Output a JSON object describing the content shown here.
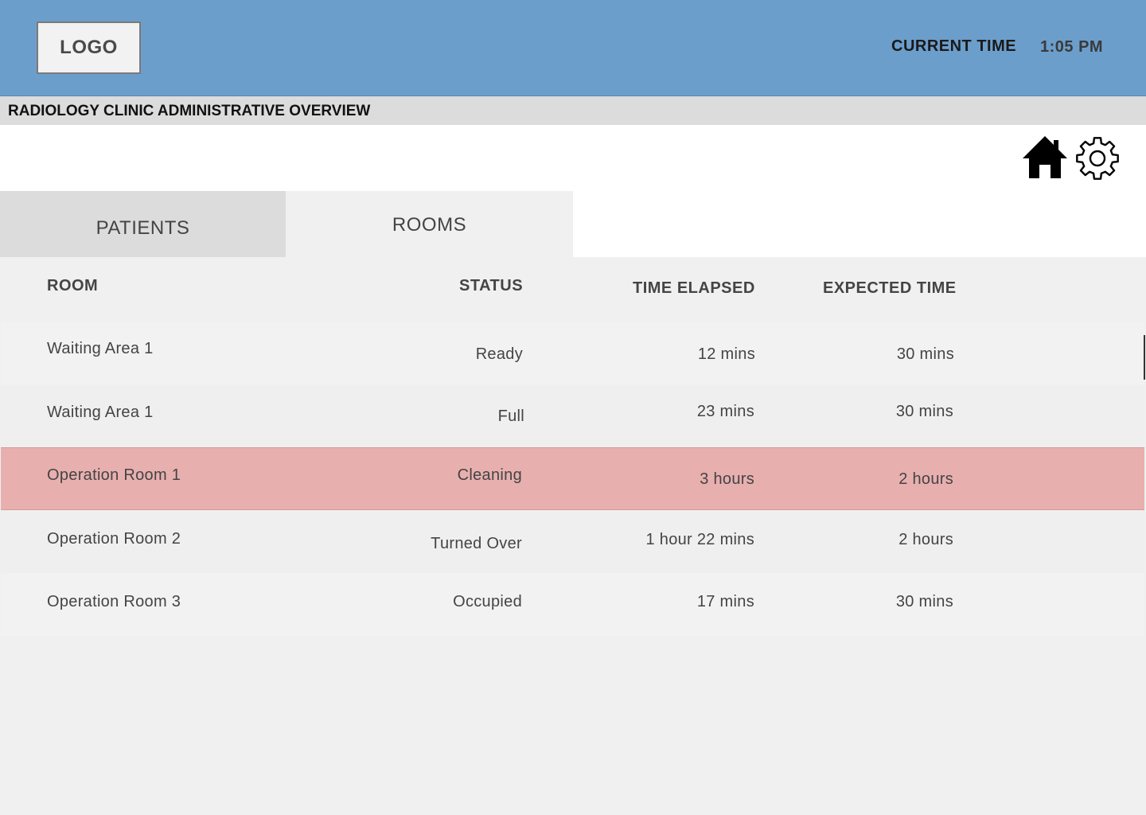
{
  "header": {
    "logo": "LOGO",
    "current_time_label": "CURRENT TIME",
    "current_time_value": "1:05 PM",
    "background_color": "#6c9ecb"
  },
  "subheader": {
    "title": "RADIOLOGY CLINIC ADMINISTRATIVE OVERVIEW"
  },
  "toolbar": {
    "icons": [
      "home-icon",
      "gear-icon"
    ]
  },
  "tabs": [
    {
      "label": "PATIENTS",
      "active": false
    },
    {
      "label": "ROOMS",
      "active": true
    }
  ],
  "table": {
    "columns": [
      "ROOM",
      "STATUS",
      "TIME ELAPSED",
      "EXPECTED TIME"
    ],
    "rows": [
      {
        "room": "Waiting Area 1",
        "status": "Ready",
        "elapsed": "12 mins",
        "expected": "30 mins",
        "highlight": false
      },
      {
        "room": "Waiting Area 1",
        "status": "Full",
        "elapsed": "23 mins",
        "expected": "30 mins",
        "highlight": false
      },
      {
        "room": "Operation Room 1",
        "status": "Cleaning",
        "elapsed": "3 hours",
        "expected": "2 hours",
        "highlight": true
      },
      {
        "room": "Operation Room 2",
        "status": "Turned Over",
        "elapsed": "1 hour 22 mins",
        "expected": "2 hours",
        "highlight": false
      },
      {
        "room": "Operation Room 3",
        "status": "Occupied",
        "elapsed": "17 mins",
        "expected": "30 mins",
        "highlight": false
      }
    ],
    "highlight_color": "#e8afaf"
  }
}
